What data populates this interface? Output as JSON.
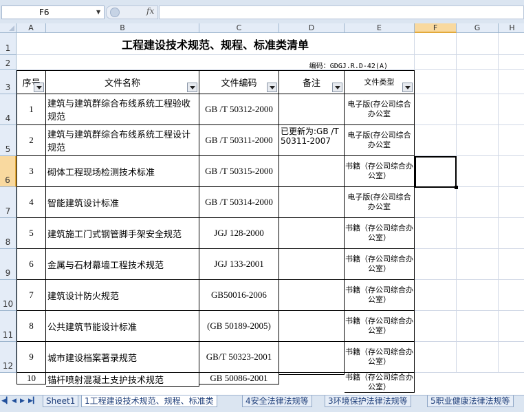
{
  "formula_bar": {
    "name_box": "F6",
    "fx_label": "fx",
    "formula": ""
  },
  "columns": [
    "A",
    "B",
    "C",
    "D",
    "E",
    "F",
    "G",
    "H"
  ],
  "row_numbers": [
    "1",
    "2",
    "3",
    "4",
    "5",
    "6",
    "7",
    "8",
    "9",
    "10",
    "11",
    "12"
  ],
  "sheet": {
    "title": "工程建设技术规范、规程、标准类清单",
    "code_label": "编码：GDGJ.R.D-42(A)",
    "headers": {
      "seq": "序号",
      "name": "文件名称",
      "code": "文件编码",
      "note": "备注",
      "type": "文件类型"
    },
    "rows": [
      {
        "seq": "1",
        "name": "建筑与建筑群综合布线系统工程验收规范",
        "code": "GB /T 50312-2000",
        "note": "",
        "type": "电子版(存公司综合办公室"
      },
      {
        "seq": "2",
        "name": "建筑与建筑群综合布线系统工程设计规范",
        "code": "GB /T 50311-2000",
        "note": "已更新为:GB /T 50311-2007",
        "type": "电子版(存公司综合办公室"
      },
      {
        "seq": "3",
        "name": "砌体工程现场检测技术标准",
        "code": "GB /T 50315-2000",
        "note": "",
        "type": "书籍（存公司综合办公室）"
      },
      {
        "seq": "4",
        "name": "智能建筑设计标准",
        "code": "GB /T 50314-2000",
        "note": "",
        "type": "电子版(存公司综合办公室"
      },
      {
        "seq": "5",
        "name": "建筑施工门式钢管脚手架安全规范",
        "code": "JGJ 128-2000",
        "note": "",
        "type": "书籍（存公司综合办公室）"
      },
      {
        "seq": "6",
        "name": "金属与石材幕墙工程技术规范",
        "code": "JGJ 133-2001",
        "note": "",
        "type": "书籍（存公司综合办公室）"
      },
      {
        "seq": "7",
        "name": "建筑设计防火规范",
        "code": "GB50016-2006",
        "note": "",
        "type": "书籍（存公司综合办公室）"
      },
      {
        "seq": "8",
        "name": "公共建筑节能设计标准",
        "code": "(GB 50189-2005)",
        "note": "",
        "type": "书籍（存公司综合办公室）"
      },
      {
        "seq": "9",
        "name": "城市建设档案著录规范",
        "code": "GB/T 50323-2001",
        "note": "",
        "type": "书籍（存公司综合办公室）"
      },
      {
        "seq": "10",
        "name": "锚杆喷射混凝土支护技术规范",
        "code": "GB 50086-2001",
        "note": "",
        "type": "书籍（存公司综合办公室）"
      }
    ]
  },
  "sheet_tabs": [
    "Sheet1",
    "1工程建设技术规范、规程、标准类",
    "4安全法律法规等",
    "3环境保护法律法规等",
    "5职业健康法律法规等"
  ]
}
